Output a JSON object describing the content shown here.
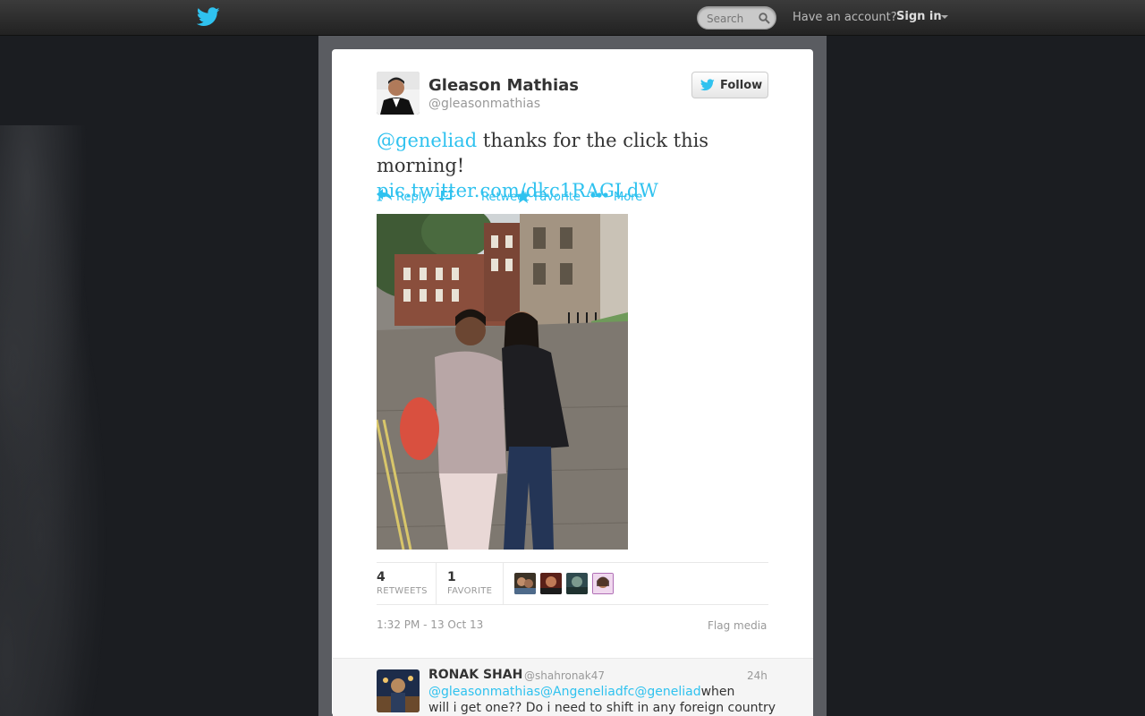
{
  "topbar": {
    "search_placeholder": "Search",
    "have_account": "Have an account?",
    "sign_in": "Sign in"
  },
  "tweet": {
    "name": "Gleason Mathias",
    "handle": "@gleasonmathias",
    "follow_label": "Follow",
    "mention": "@geneliad",
    "text": " thanks for the click this morning!",
    "pic_link": "pic.twitter.com/dkc1RAGLdW",
    "actions": {
      "reply": "Reply",
      "retweet": "Retweet",
      "favorite": "Favorite",
      "more": "More"
    },
    "retweets_count": "4",
    "retweets_label": "RETWEETS",
    "favorites_count": "1",
    "favorites_label": "FAVORITE",
    "timestamp": "1:32 PM - 13 Oct 13",
    "flag_media": "Flag media"
  },
  "reply": {
    "name": "RONAK SHAH",
    "handle": "@shahronak47",
    "time": "24h",
    "mentions": "@gleasonmathias@Angeneliadfc@geneliad",
    "text_tail": "when",
    "text_line2": "will i get one?? Do i need to shift in any foreign country"
  },
  "colors": {
    "link": "#2fc2ef",
    "background": "#1b1d21",
    "container": "#5a5c61"
  }
}
